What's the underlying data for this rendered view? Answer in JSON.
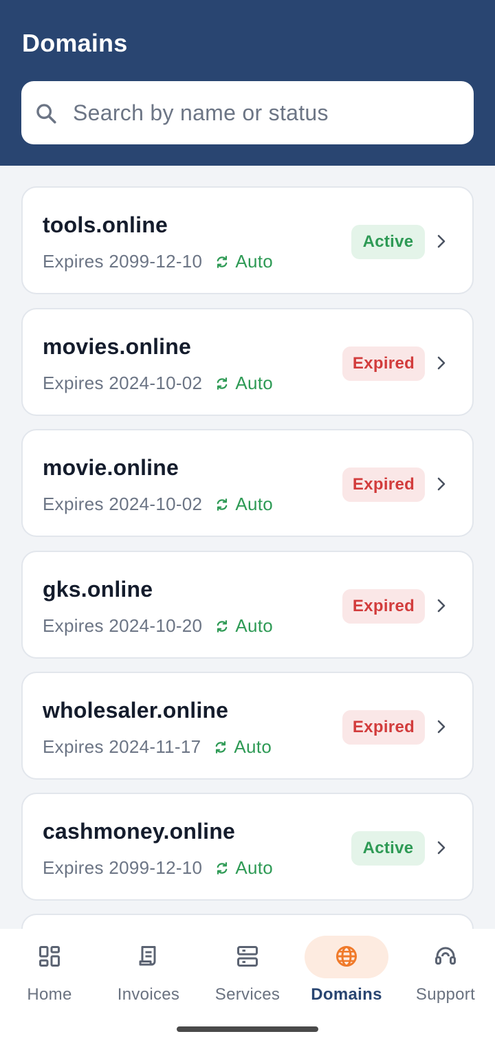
{
  "header": {
    "title": "Domains"
  },
  "search": {
    "placeholder": "Search by name or status",
    "value": ""
  },
  "domains": [
    {
      "name": "tools.online",
      "expires_label": "Expires 2099-12-10",
      "renew": "Auto",
      "status": "Active"
    },
    {
      "name": "movies.online",
      "expires_label": "Expires 2024-10-02",
      "renew": "Auto",
      "status": "Expired"
    },
    {
      "name": "movie.online",
      "expires_label": "Expires 2024-10-02",
      "renew": "Auto",
      "status": "Expired"
    },
    {
      "name": "gks.online",
      "expires_label": "Expires 2024-10-20",
      "renew": "Auto",
      "status": "Expired"
    },
    {
      "name": "wholesaler.online",
      "expires_label": "Expires 2024-11-17",
      "renew": "Auto",
      "status": "Expired"
    },
    {
      "name": "cashmoney.online",
      "expires_label": "Expires 2099-12-10",
      "renew": "Auto",
      "status": "Active"
    }
  ],
  "nav": {
    "items": [
      {
        "label": "Home",
        "icon": "dashboard-icon"
      },
      {
        "label": "Invoices",
        "icon": "receipt-icon"
      },
      {
        "label": "Services",
        "icon": "server-icon"
      },
      {
        "label": "Domains",
        "icon": "globe-icon"
      },
      {
        "label": "Support",
        "icon": "headset-icon"
      }
    ],
    "selected": "Domains"
  },
  "colors": {
    "header": "#294571",
    "active_text": "#2e9a55",
    "active_bg": "#e4f4e9",
    "expired_text": "#d23c3c",
    "expired_bg": "#fae7e7",
    "nav_selected_bg": "#fdebe0",
    "nav_selected_icon": "#f07a2a"
  }
}
